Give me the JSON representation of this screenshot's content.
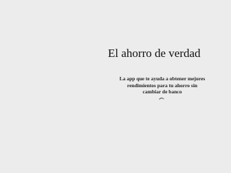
{
  "hero": {
    "title": "El ahorro de verdad",
    "subtitle": "La app que te ayuda a obtener mejores rendimientos para tu ahorro sin cambiar de banco"
  },
  "loader": {
    "icon": "loading-spinner-icon"
  }
}
